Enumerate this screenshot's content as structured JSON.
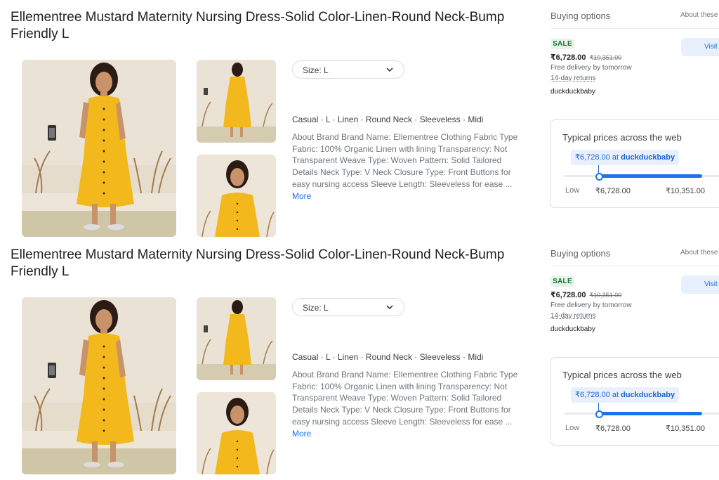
{
  "products": [
    {
      "title": "Ellementree Mustard Maternity Nursing Dress-Solid Color-Linen-Round Neck-Bump Friendly L",
      "size_label": "Size: L",
      "attributes": "Casual · L · Linen · Round Neck · Sleeveless · Midi",
      "description": "About Brand Brand Name: Ellementree Clothing Fabric Type Fabric: 100% Organic Linen with lining Transparency: Not Transparent Weave Type: Woven Pattern: Solid Tailored Details Neck Type: V Neck Closure Type: Front Buttons for easy nursing access Sleeve Length: Sleeveless for ease ...",
      "more_label": "More",
      "buying": {
        "title": "Buying options",
        "about": "About these",
        "sale": "SALE",
        "price": "₹6,728.00",
        "old_price": "₹10,351.00",
        "delivery": "Free delivery by tomorrow",
        "returns": "14-day returns",
        "seller": "duckduckbaby",
        "visit": "Visit"
      },
      "typical": {
        "title": "Typical prices across the web",
        "pill_price": "₹6,728.00 at",
        "pill_seller": "duckduckbaby",
        "low_label": "Low",
        "low_value": "₹6,728.00",
        "high_value": "₹10,351.00"
      }
    },
    {
      "title": "Ellementree Mustard Maternity Nursing Dress-Solid Color-Linen-Round Neck-Bump Friendly L",
      "size_label": "Size: L",
      "attributes": "Casual · L · Linen · Round Neck · Sleeveless · Midi",
      "description": "About Brand Brand Name: Ellementree Clothing Fabric Type Fabric: 100% Organic Linen with lining Transparency: Not Transparent Weave Type: Woven Pattern: Solid Tailored Details Neck Type: V Neck Closure Type: Front Buttons for easy nursing access Sleeve Length: Sleeveless for ease ...",
      "more_label": "More",
      "buying": {
        "title": "Buying options",
        "about": "About these",
        "sale": "SALE",
        "price": "₹6,728.00",
        "old_price": "₹10,351.00",
        "delivery": "Free delivery by tomorrow",
        "returns": "14-day returns",
        "seller": "duckduckbaby",
        "visit": "Visit"
      },
      "typical": {
        "title": "Typical prices across the web",
        "pill_price": "₹6,728.00 at",
        "pill_seller": "duckduckbaby",
        "low_label": "Low",
        "low_value": "₹6,728.00",
        "high_value": "₹10,351.00"
      }
    }
  ],
  "colors": {
    "dress": "#f2b81c",
    "accent_blue": "#1a73e8",
    "sale_green": "#137333"
  },
  "icons": [
    "chevron-down-icon"
  ]
}
